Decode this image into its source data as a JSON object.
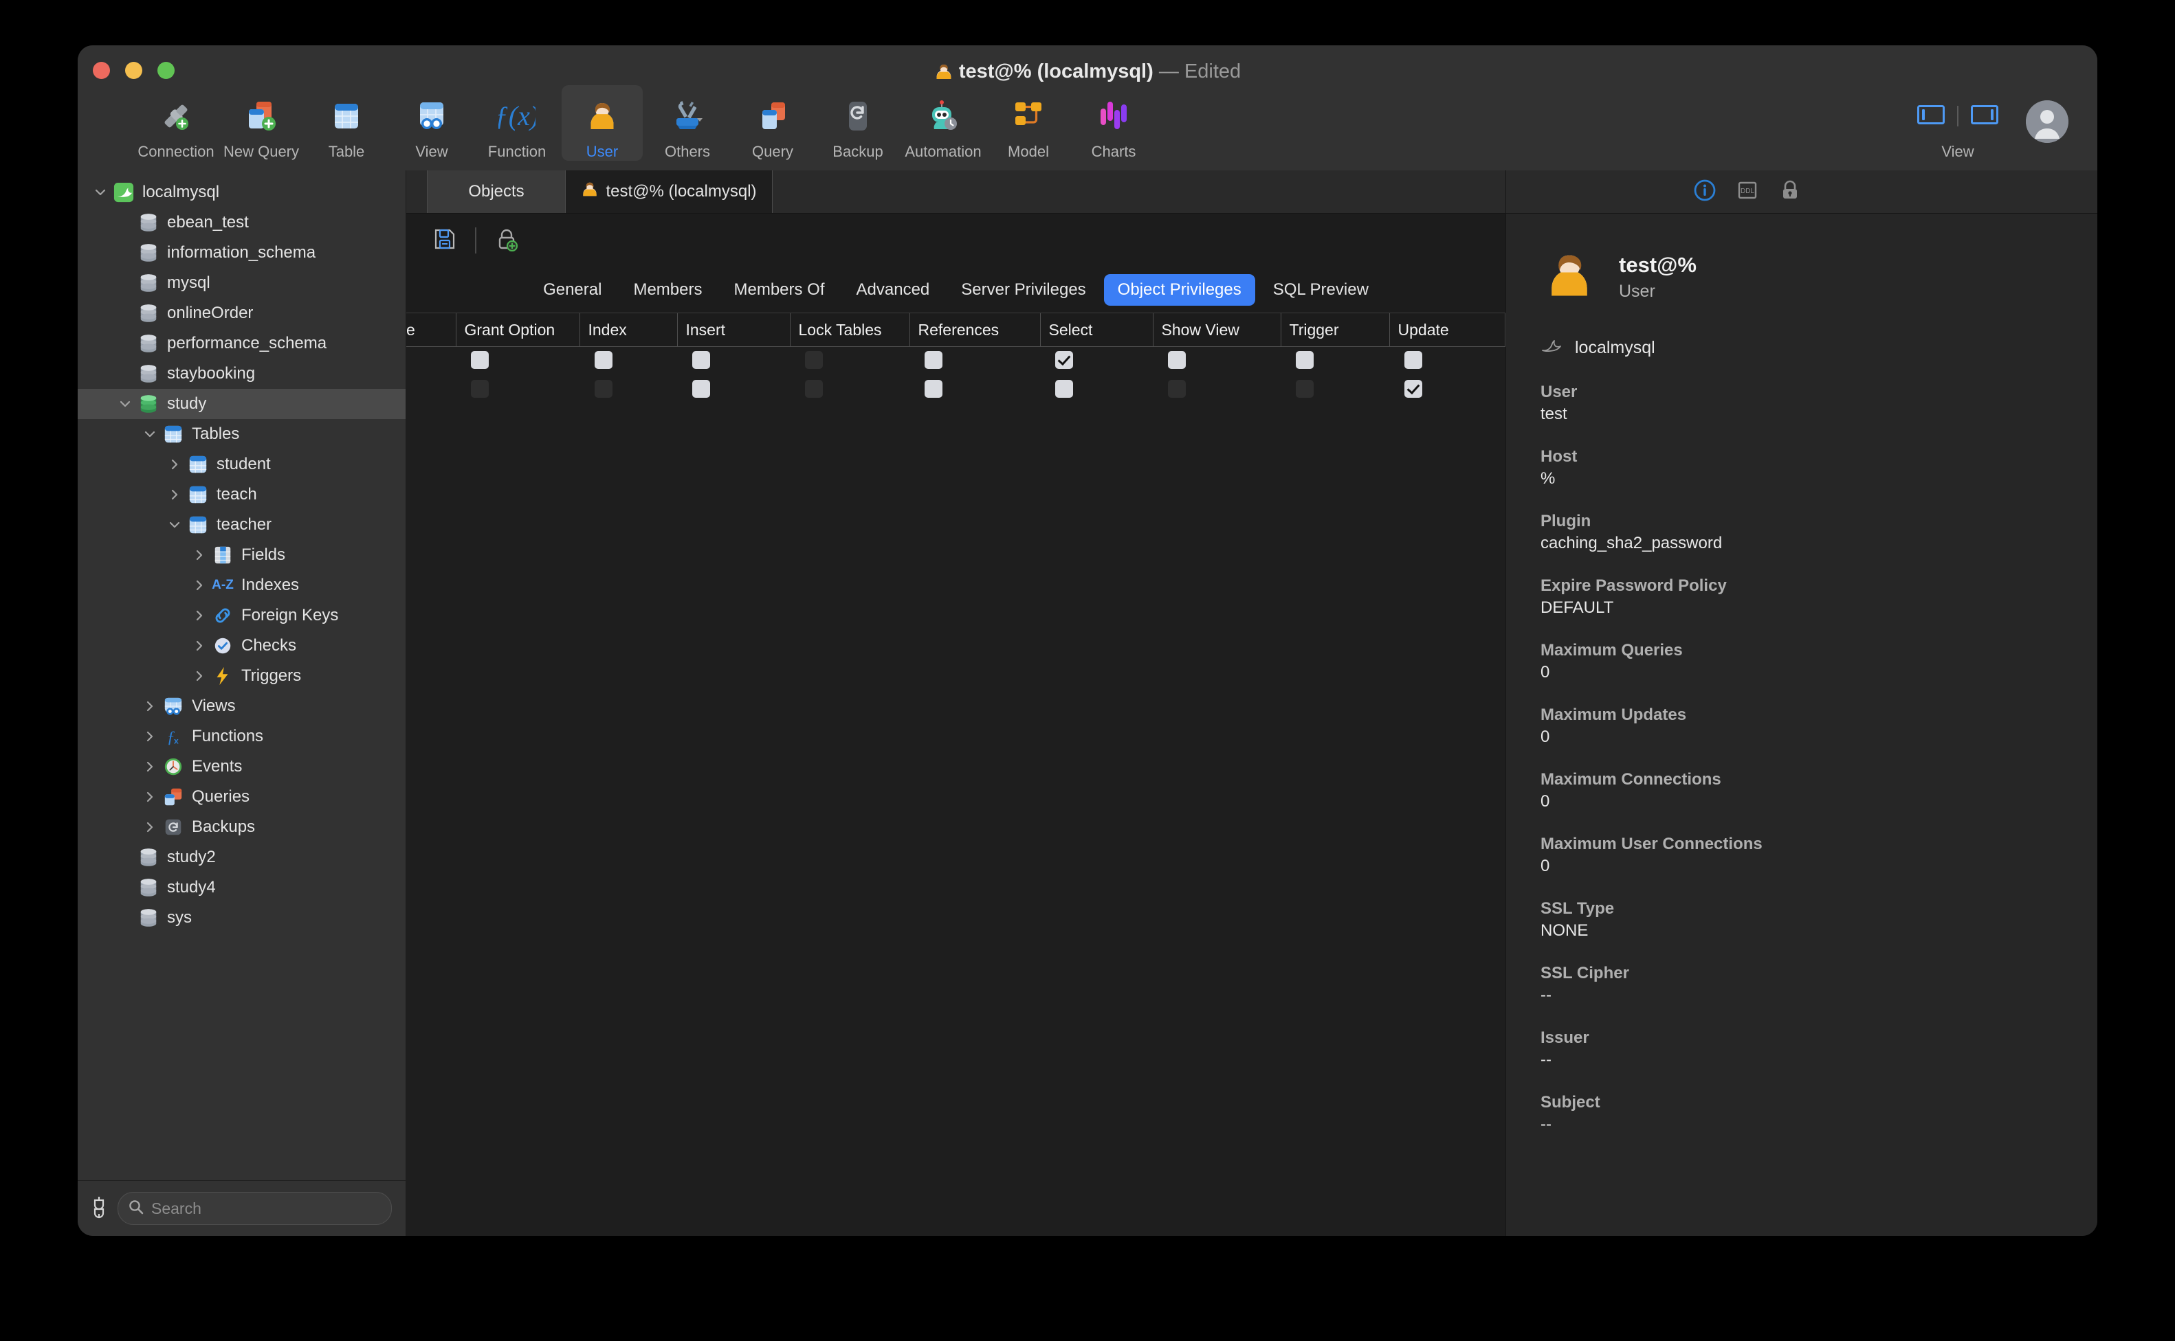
{
  "window": {
    "title_user": "test@%",
    "title_conn": "(localmysql)",
    "title_state": "— Edited"
  },
  "toolbar": {
    "items": [
      {
        "label": "Connection",
        "icon": "connection-icon"
      },
      {
        "label": "New Query",
        "icon": "new-query-icon"
      },
      {
        "label": "Table",
        "icon": "table-icon"
      },
      {
        "label": "View",
        "icon": "view-icon"
      },
      {
        "label": "Function",
        "icon": "function-icon"
      },
      {
        "label": "User",
        "icon": "user-icon"
      },
      {
        "label": "Others",
        "icon": "others-icon"
      },
      {
        "label": "Query",
        "icon": "query-icon"
      },
      {
        "label": "Backup",
        "icon": "backup-icon"
      },
      {
        "label": "Automation",
        "icon": "automation-icon"
      },
      {
        "label": "Model",
        "icon": "model-icon"
      },
      {
        "label": "Charts",
        "icon": "charts-icon"
      }
    ],
    "active": "User",
    "view_label": "View"
  },
  "sidebar": {
    "search_placeholder": "Search",
    "tree": [
      {
        "label": "localmysql",
        "depth": 0,
        "twisty": "down",
        "icon": "mysql-dolphin-icon",
        "selected": false
      },
      {
        "label": "ebean_test",
        "depth": 1,
        "twisty": "none",
        "icon": "database-icon",
        "selected": false
      },
      {
        "label": "information_schema",
        "depth": 1,
        "twisty": "none",
        "icon": "database-icon",
        "selected": false
      },
      {
        "label": "mysql",
        "depth": 1,
        "twisty": "none",
        "icon": "database-icon",
        "selected": false
      },
      {
        "label": "onlineOrder",
        "depth": 1,
        "twisty": "none",
        "icon": "database-icon",
        "selected": false
      },
      {
        "label": "performance_schema",
        "depth": 1,
        "twisty": "none",
        "icon": "database-icon",
        "selected": false
      },
      {
        "label": "staybooking",
        "depth": 1,
        "twisty": "none",
        "icon": "database-icon",
        "selected": false
      },
      {
        "label": "study",
        "depth": 1,
        "twisty": "down",
        "icon": "database-open-icon",
        "selected": true
      },
      {
        "label": "Tables",
        "depth": 2,
        "twisty": "down",
        "icon": "tables-icon",
        "selected": false
      },
      {
        "label": "student",
        "depth": 3,
        "twisty": "right",
        "icon": "table-icon",
        "selected": false
      },
      {
        "label": "teach",
        "depth": 3,
        "twisty": "right",
        "icon": "table-icon",
        "selected": false
      },
      {
        "label": "teacher",
        "depth": 3,
        "twisty": "down",
        "icon": "table-icon",
        "selected": false
      },
      {
        "label": "Fields",
        "depth": 4,
        "twisty": "right",
        "icon": "fields-icon",
        "selected": false
      },
      {
        "label": "Indexes",
        "depth": 4,
        "twisty": "right",
        "icon": "indexes-icon",
        "selected": false
      },
      {
        "label": "Foreign Keys",
        "depth": 4,
        "twisty": "right",
        "icon": "foreign-keys-icon",
        "selected": false
      },
      {
        "label": "Checks",
        "depth": 4,
        "twisty": "right",
        "icon": "checks-icon",
        "selected": false
      },
      {
        "label": "Triggers",
        "depth": 4,
        "twisty": "right",
        "icon": "triggers-icon",
        "selected": false
      },
      {
        "label": "Views",
        "depth": 2,
        "twisty": "right",
        "icon": "views-icon",
        "selected": false
      },
      {
        "label": "Functions",
        "depth": 2,
        "twisty": "right",
        "icon": "functions-icon",
        "selected": false
      },
      {
        "label": "Events",
        "depth": 2,
        "twisty": "right",
        "icon": "events-icon",
        "selected": false
      },
      {
        "label": "Queries",
        "depth": 2,
        "twisty": "right",
        "icon": "queries-icon",
        "selected": false
      },
      {
        "label": "Backups",
        "depth": 2,
        "twisty": "right",
        "icon": "backups-icon",
        "selected": false
      },
      {
        "label": "study2",
        "depth": 1,
        "twisty": "none",
        "icon": "database-icon",
        "selected": false
      },
      {
        "label": "study4",
        "depth": 1,
        "twisty": "none",
        "icon": "database-icon",
        "selected": false
      },
      {
        "label": "sys",
        "depth": 1,
        "twisty": "none",
        "icon": "database-icon",
        "selected": false
      }
    ]
  },
  "center": {
    "tabs": [
      {
        "label": "Objects",
        "active": false,
        "icon": null
      },
      {
        "label": "test@% (localmysql)",
        "active": true,
        "icon": "user-icon"
      }
    ],
    "doc_toolbar": [
      {
        "icon": "save-icon",
        "label": "Save"
      },
      {
        "icon": "add-privilege-icon",
        "label": "Add Privilege"
      }
    ],
    "segments": [
      {
        "label": "General",
        "active": false
      },
      {
        "label": "Members",
        "active": false
      },
      {
        "label": "Members Of",
        "active": false
      },
      {
        "label": "Advanced",
        "active": false
      },
      {
        "label": "Server Privileges",
        "active": false
      },
      {
        "label": "Object Privileges",
        "active": true
      },
      {
        "label": "SQL Preview",
        "active": false
      }
    ],
    "grid": {
      "columns": [
        "e",
        "Grant Option",
        "Index",
        "Insert",
        "Lock Tables",
        "References",
        "Select",
        "Show View",
        "Trigger",
        "Update"
      ],
      "rows": [
        [
          "",
          "off",
          "off",
          "off",
          "disabled",
          "off",
          "on",
          "off",
          "off",
          "off"
        ],
        [
          "",
          "disabled",
          "disabled",
          "off",
          "disabled",
          "off",
          "off",
          "disabled",
          "disabled",
          "on"
        ]
      ]
    }
  },
  "inspector": {
    "header_icons": [
      {
        "icon": "info-icon",
        "active": true
      },
      {
        "icon": "ddl-icon",
        "active": false
      },
      {
        "icon": "lock-icon",
        "active": false
      }
    ],
    "title": "test@%",
    "subtitle": "User",
    "connection": "localmysql",
    "properties": [
      {
        "key": "User",
        "value": "test"
      },
      {
        "key": "Host",
        "value": "%"
      },
      {
        "key": "Plugin",
        "value": "caching_sha2_password"
      },
      {
        "key": "Expire Password Policy",
        "value": "DEFAULT"
      },
      {
        "key": "Maximum Queries",
        "value": "0"
      },
      {
        "key": "Maximum Updates",
        "value": "0"
      },
      {
        "key": "Maximum Connections",
        "value": "0"
      },
      {
        "key": "Maximum User Connections",
        "value": "0"
      },
      {
        "key": "SSL Type",
        "value": "NONE"
      },
      {
        "key": "SSL Cipher",
        "value": "--"
      },
      {
        "key": "Issuer",
        "value": "--"
      },
      {
        "key": "Subject",
        "value": "--"
      }
    ]
  },
  "colors": {
    "accent": "#3b7ef5",
    "window_bg": "#2c2c2c",
    "sidebar_bg": "#323232",
    "center_bg": "#1e1e1e",
    "inspector_bg": "#262626"
  }
}
